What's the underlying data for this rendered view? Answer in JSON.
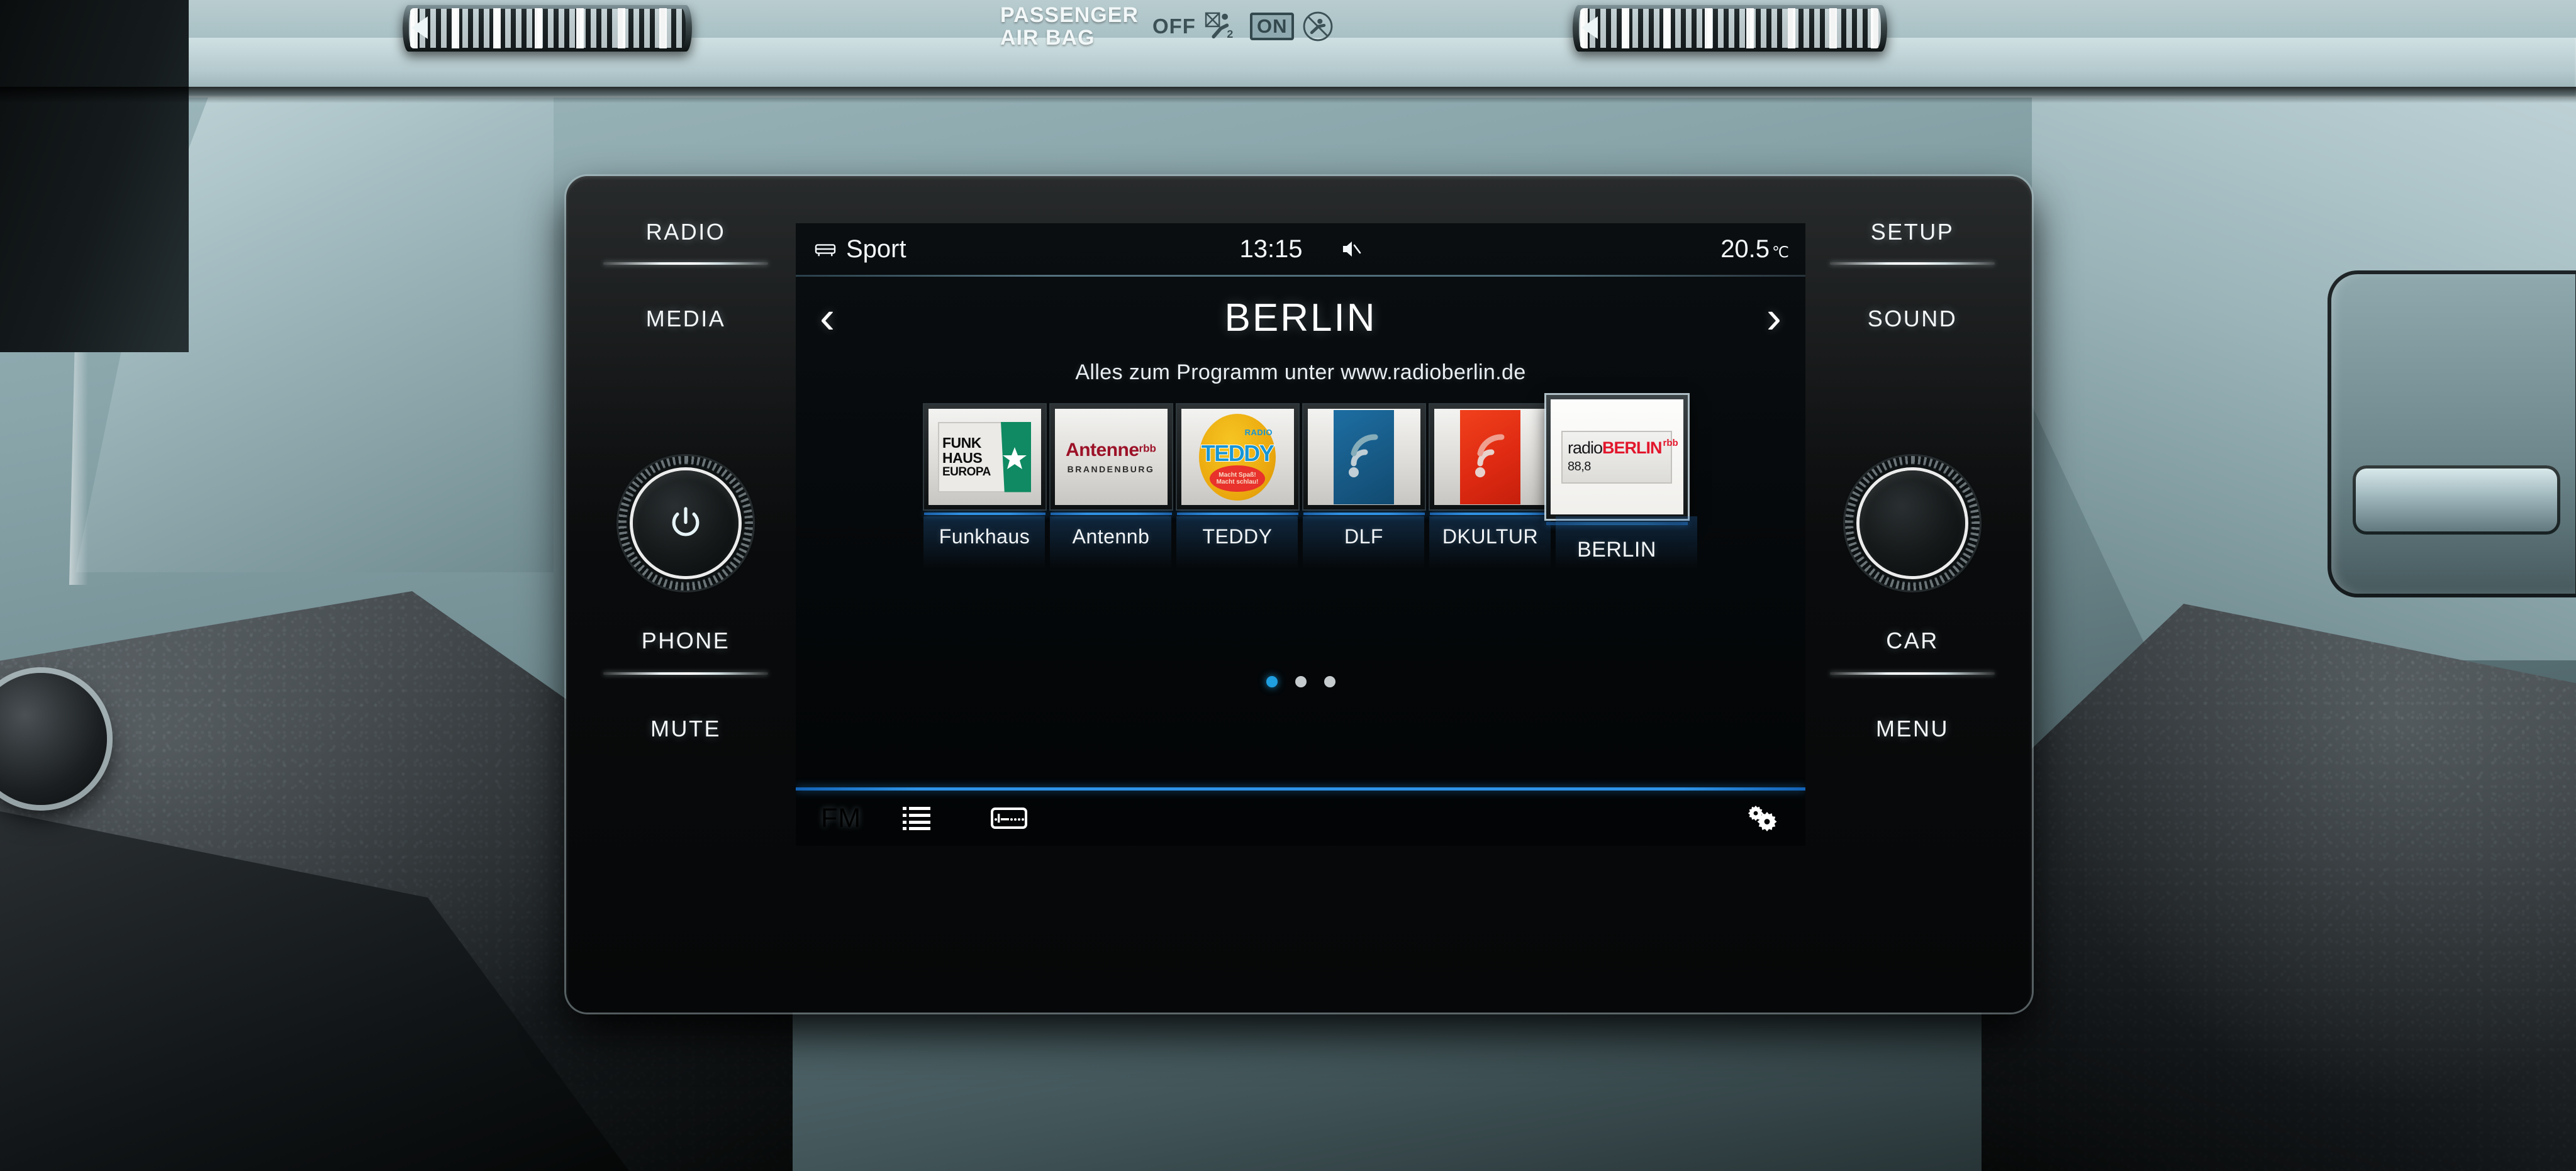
{
  "vehicle": {
    "airbag": {
      "label_line1": "PASSENGER",
      "label_line2": "AIR BAG",
      "off_label": "OFF",
      "on_label": "ON",
      "off_icon": "airbag-off-icon",
      "on_icon": "airbag-disabled-icon"
    }
  },
  "hardware": {
    "left": [
      {
        "label": "RADIO"
      },
      {
        "label": "MEDIA"
      },
      {
        "label": "PHONE"
      },
      {
        "label": "MUTE"
      }
    ],
    "right": [
      {
        "label": "SETUP"
      },
      {
        "label": "SOUND"
      },
      {
        "label": "CAR"
      },
      {
        "label": "MENU"
      }
    ],
    "power_knob": {
      "icon": "power-icon"
    },
    "tune_knob": {
      "icon": "tune-knob"
    }
  },
  "screen": {
    "status": {
      "profile_icon": "car-profile-icon",
      "profile": "Sport",
      "time": "13:15",
      "mute_icon": "speaker-mute-icon",
      "temperature": "20.5",
      "temperature_unit": "℃"
    },
    "nav": {
      "prev_icon": "chevron-left-icon",
      "next_icon": "chevron-right-icon",
      "station_title": "BERLIN"
    },
    "subtitle": "Alles zum Programm unter www.radioberlin.de",
    "presets": [
      {
        "name": "Funkhaus",
        "logo_kind": "funkhaus",
        "logo_lines": [
          "FUNK",
          "HAUS",
          "EUROPA"
        ],
        "accent": "#0f8a62",
        "selected": false
      },
      {
        "name": "Antennb",
        "logo_kind": "antenne",
        "logo_main": "Antenne",
        "logo_sup": "rbb",
        "logo_sub": "BRANDENBURG",
        "accent": "#9c1228",
        "selected": false
      },
      {
        "name": "TEDDY",
        "logo_kind": "teddy",
        "logo_top": "RADIO",
        "logo_main": "TEDDY",
        "logo_tag1": "Macht Spaß!",
        "logo_tag2": "Macht schlau!",
        "accent": "#f0b418",
        "selected": false
      },
      {
        "name": "DLF",
        "logo_kind": "wave",
        "accent": "#1d6ea3",
        "selected": false
      },
      {
        "name": "DKULTUR",
        "logo_kind": "wave",
        "accent": "#f0411c",
        "selected": false
      },
      {
        "name": "BERLIN",
        "logo_kind": "radioberlin",
        "logo_part1": "radio",
        "logo_part2": "BERLIN",
        "logo_sup": "rbb",
        "logo_freq": "88,8",
        "accent": "#e2172c",
        "selected": true
      }
    ],
    "pager": {
      "count": 3,
      "active": 1
    },
    "toolbar": {
      "band_label": "FM",
      "list_icon": "list-icon",
      "tune_icon": "manual-tune-icon",
      "settings_icon": "settings-gears-icon"
    },
    "colors": {
      "accent": "#2e93e6",
      "active_dot": "#1f9ee0",
      "text": "#ffffff"
    }
  }
}
